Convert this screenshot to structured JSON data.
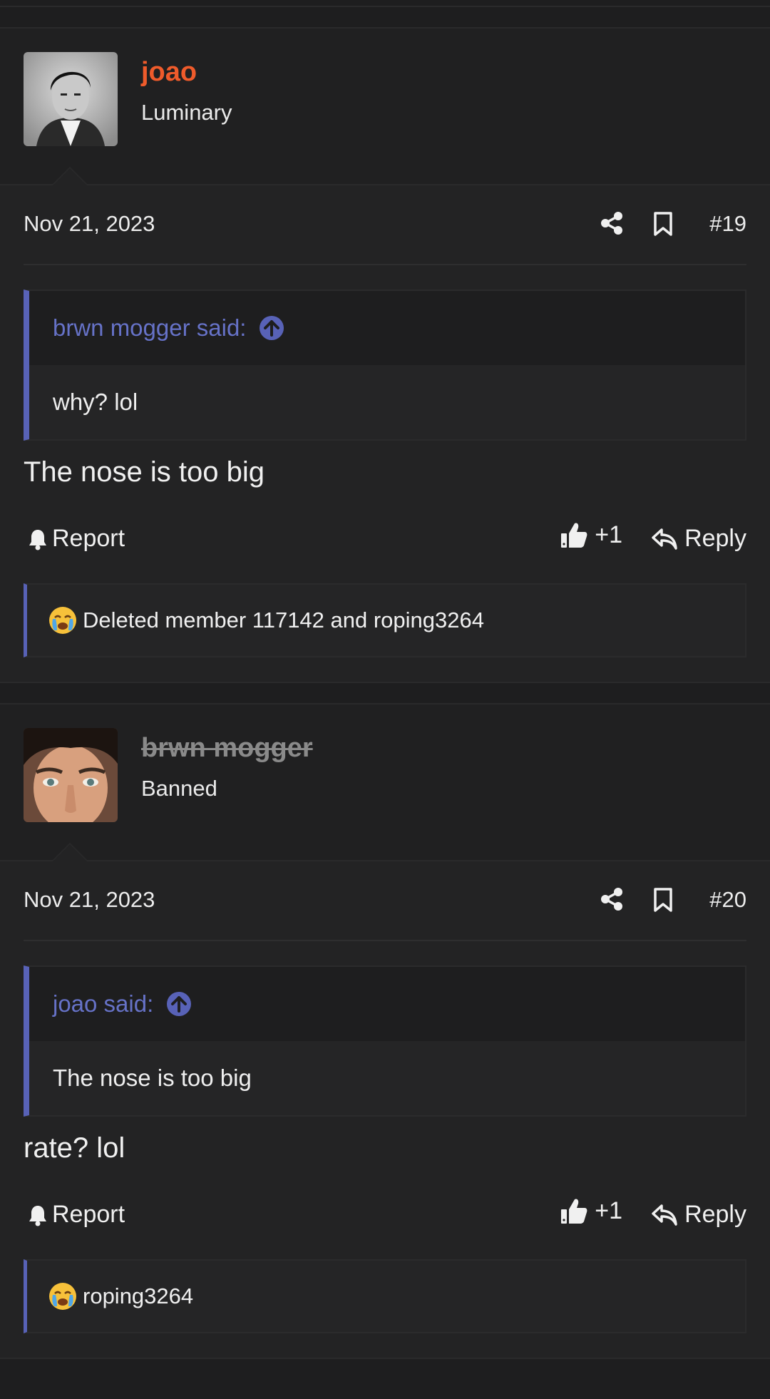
{
  "posts": [
    {
      "author": "joao",
      "author_title": "Luminary",
      "date": "Nov 21, 2023",
      "number": "#19",
      "quote": {
        "author_line": "brwn mogger said:",
        "text": "why? lol"
      },
      "text": "The nose is too big",
      "actions": {
        "report": "Report",
        "like": "+1",
        "reply": "Reply"
      },
      "reactions": "Deleted member 117142 and roping3264"
    },
    {
      "author": "brwn mogger",
      "author_title": "Banned",
      "date": "Nov 21, 2023",
      "number": "#20",
      "quote": {
        "author_line": "joao said:",
        "text": "The nose is too big"
      },
      "text": "rate? lol",
      "actions": {
        "report": "Report",
        "like": "+1",
        "reply": "Reply"
      },
      "reactions": "roping3264"
    }
  ],
  "colors": {
    "background": "#1e1e1f",
    "username_accent": "#ef5b2b",
    "quote_accent": "#5862b7",
    "banned_username": "#8a8a8a"
  },
  "icons": [
    "share-icon",
    "bookmark-icon",
    "arrow-up-circle-icon",
    "bell-icon",
    "thumbs-up-icon",
    "reply-icon",
    "crying-face-icon"
  ]
}
